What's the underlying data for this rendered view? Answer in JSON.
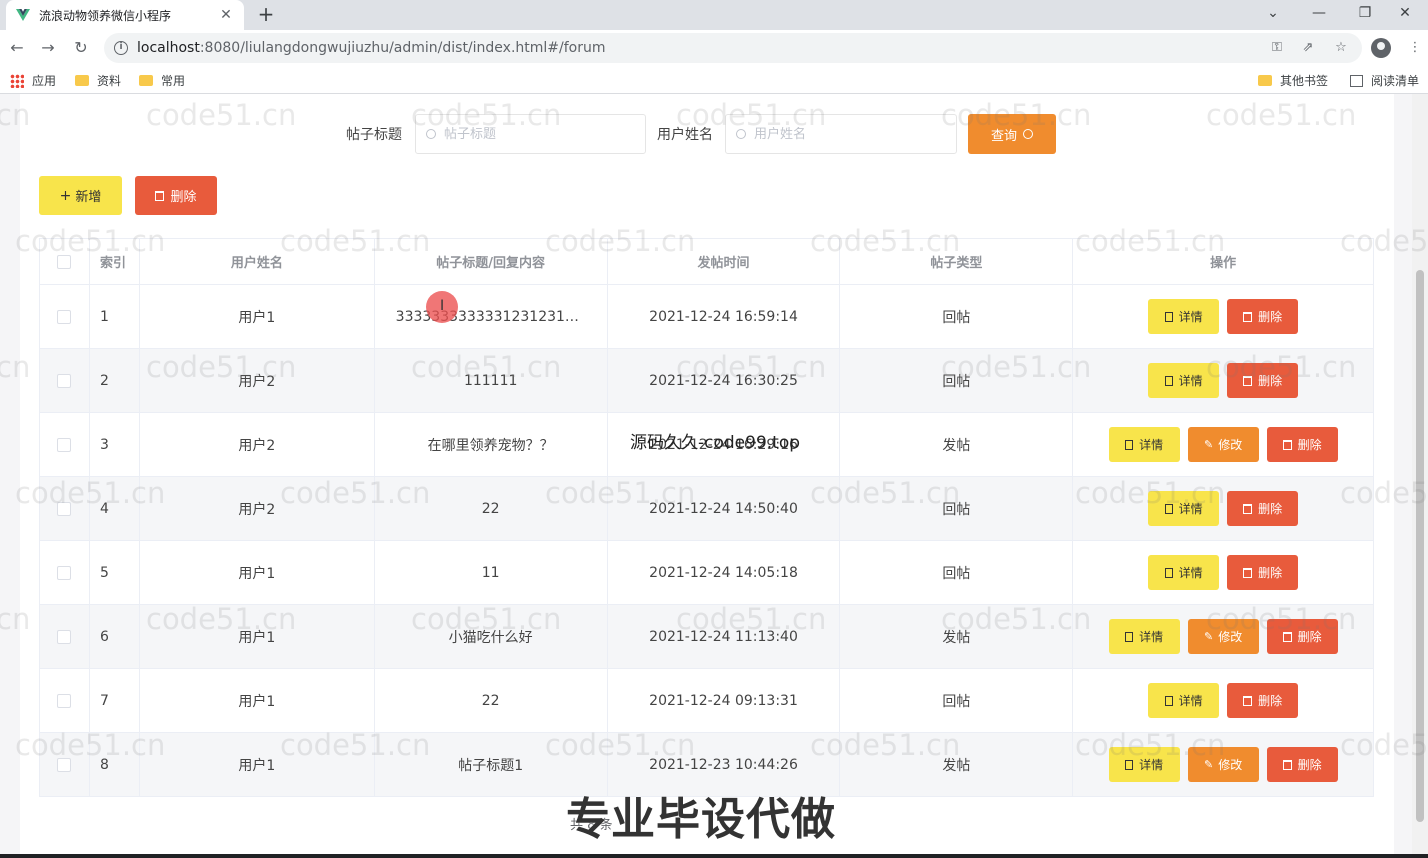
{
  "browser": {
    "tab_title": "流浪动物领养微信小程序",
    "url_host": "localhost",
    "url_rest": ":8080/liulangdongwujiuzhu/admin/dist/index.html#/forum",
    "bookmarks": [
      "应用",
      "资料",
      "常用",
      "其他书签",
      "阅读清单"
    ]
  },
  "search": {
    "title_label": "帖子标题",
    "title_placeholder": "帖子标题",
    "user_label": "用户姓名",
    "user_placeholder": "用户姓名",
    "query_label": "查询"
  },
  "actions": {
    "add_label": "新增",
    "delete_label": "删除"
  },
  "table": {
    "headers": [
      "索引",
      "用户姓名",
      "帖子标题/回复内容",
      "发帖时间",
      "帖子类型",
      "操作"
    ],
    "rows": [
      {
        "index": "1",
        "user": "用户1",
        "title": "33333333333312312313...",
        "time": "2021-12-24 16:59:14",
        "type": "回帖",
        "editable": false
      },
      {
        "index": "2",
        "user": "用户2",
        "title": "111111",
        "time": "2021-12-24 16:30:25",
        "type": "回帖",
        "editable": false
      },
      {
        "index": "3",
        "user": "用户2",
        "title": "在哪里领养宠物？？",
        "time": "2021-12-24 16:29:16",
        "type": "发帖",
        "editable": true
      },
      {
        "index": "4",
        "user": "用户2",
        "title": "22",
        "time": "2021-12-24 14:50:40",
        "type": "回帖",
        "editable": false
      },
      {
        "index": "5",
        "user": "用户1",
        "title": "11",
        "time": "2021-12-24 14:05:18",
        "type": "回帖",
        "editable": false
      },
      {
        "index": "6",
        "user": "用户1",
        "title": "小猫吃什么好",
        "time": "2021-12-24 11:13:40",
        "type": "发帖",
        "editable": true
      },
      {
        "index": "7",
        "user": "用户1",
        "title": "22",
        "time": "2021-12-24 09:13:31",
        "type": "回帖",
        "editable": false
      },
      {
        "index": "8",
        "user": "用户1",
        "title": "帖子标题1",
        "time": "2021-12-23 10:44:26",
        "type": "发帖",
        "editable": true
      }
    ],
    "op_labels": {
      "detail": "详情",
      "edit": "修改",
      "delete": "删除"
    }
  },
  "pagination": {
    "text": "共 8 条"
  },
  "overlays": {
    "watermark": "code51.cn",
    "mid_text": "源码久久-code99.top",
    "big_text": "专业毕设代做"
  },
  "colors": {
    "yellow_button": "#f8e44b",
    "orange_button": "#f08c2e",
    "red_button": "#e85b3c"
  }
}
